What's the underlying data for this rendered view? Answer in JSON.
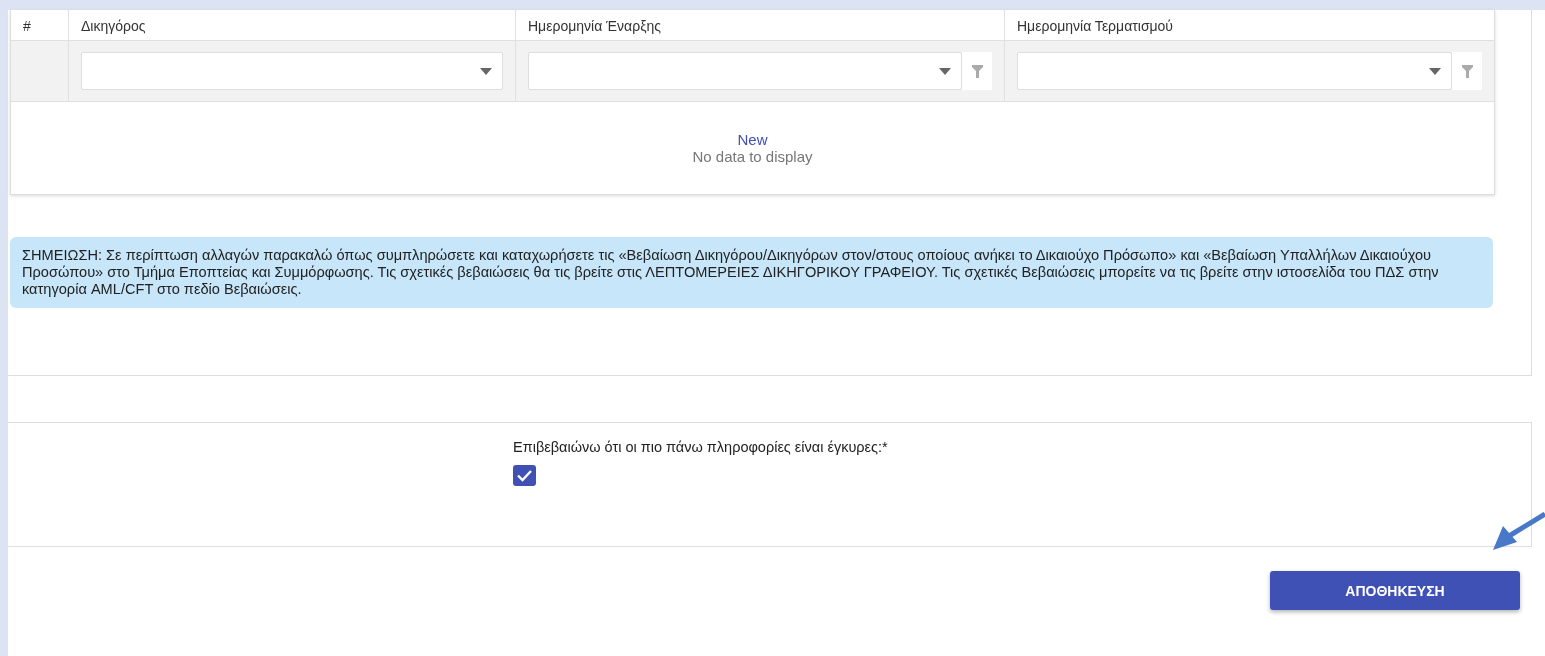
{
  "table": {
    "columns": [
      {
        "label": "#",
        "kind": "index"
      },
      {
        "label": "Δικηγόρος",
        "kind": "select"
      },
      {
        "label": "Ημερομηνία Έναρξης",
        "kind": "select-filter"
      },
      {
        "label": "Ημερομηνία Τερματισμού",
        "kind": "select-filter"
      }
    ],
    "new_link": "New",
    "empty_text": "No data to display"
  },
  "note": "ΣΗΜΕΙΩΣΗ: Σε περίπτωση αλλαγών παρακαλώ όπως συμπληρώσετε και καταχωρήσετε τις «Βεβαίωση Δικηγόρου/Δικηγόρων στον/στους οποίους ανήκει το Δικαιούχο Πρόσωπο» και «Βεβαίωση Υπαλλήλων Δικαιούχου Προσώπου» στο Τμήμα Εποπτείας και Συμμόρφωσης. Τις σχετικές βεβαιώσεις θα τις βρείτε στις ΛΕΠΤΟΜΕΡΕΙΕΣ ΔΙΚΗΓΟΡΙΚΟΥ ΓΡΑΦΕΙΟΥ. Τις σχετικές Βεβαιώσεις μπορείτε να τις βρείτε στην ιστοσελίδα του ΠΔΣ στην κατηγορία AML/CFT στο πεδίο Βεβαιώσεις.",
  "confirm": {
    "label": "Επιβεβαιώνω ότι οι πιο πάνω πληροφορίες είναι έγκυρες:",
    "required_mark": "*",
    "checked": true
  },
  "save_button": "ΑΠΟΘΗΚΕΥΣΗ"
}
